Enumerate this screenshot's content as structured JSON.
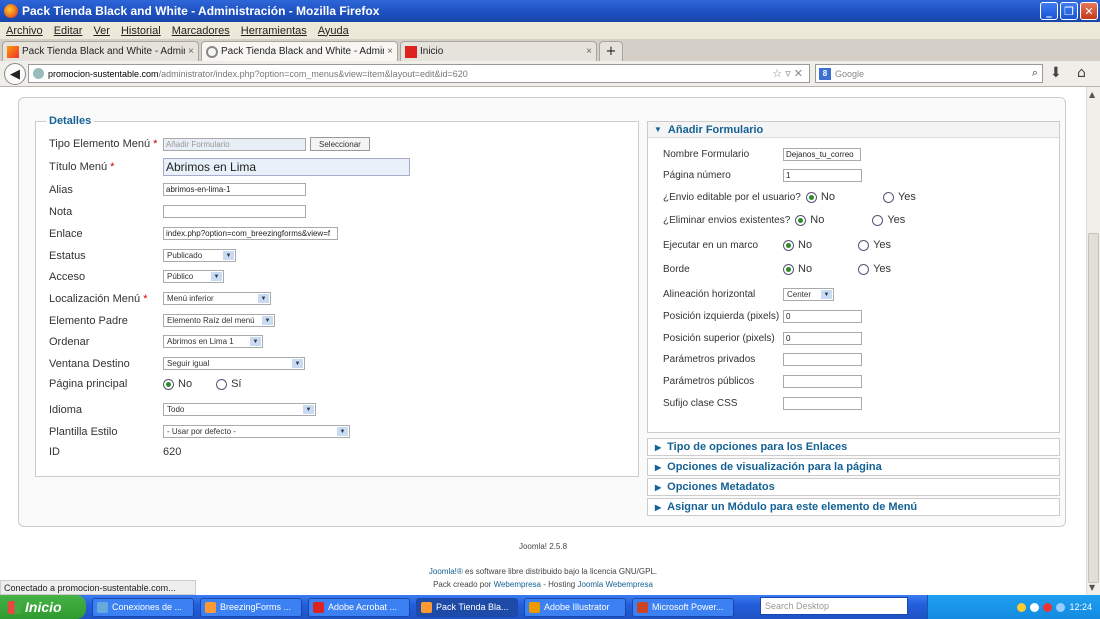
{
  "window": {
    "title": "Pack Tienda Black and White - Administración - Mozilla Firefox"
  },
  "menu": [
    "Archivo",
    "Editar",
    "Ver",
    "Historial",
    "Marcadores",
    "Herramientas",
    "Ayuda"
  ],
  "tabs": [
    {
      "label": "Pack Tienda Black and White - Administra...",
      "close": "×"
    },
    {
      "label": "Pack Tienda Black and White - Administra...",
      "close": "×"
    },
    {
      "label": "Inicio",
      "close": "×"
    }
  ],
  "address": {
    "host": "promocion-sustentable.com",
    "path": "/administrator/index.php?option=com_menus&view=item&layout=edit&id=620",
    "search_placeholder": "Google"
  },
  "details": {
    "legend": "Detalles",
    "fields": {
      "tipo_label": "Tipo Elemento Menú",
      "tipo_value": "Añadir Formulario",
      "select_btn": "Seleccionar",
      "titulo_label": "Título Menú",
      "titulo_value": "Abrimos en Lima",
      "alias_label": "Alias",
      "alias_value": "abrimos-en-lima-1",
      "nota_label": "Nota",
      "nota_value": "",
      "enlace_label": "Enlace",
      "enlace_value": "index.php?option=com_breezingforms&view=f",
      "estatus_label": "Estatus",
      "estatus_value": "Publicado",
      "acceso_label": "Acceso",
      "acceso_value": "Público",
      "localizacion_label": "Localización Menú",
      "localizacion_value": "Menú inferior",
      "padre_label": "Elemento Padre",
      "padre_value": "Elemento Raíz del menú",
      "ordenar_label": "Ordenar",
      "ordenar_value": "Abrimos en Lima 1",
      "ventana_label": "Ventana Destino",
      "ventana_value": "Seguir igual",
      "pagina_label": "Página principal",
      "pagina_no": "No",
      "pagina_si": "Sí",
      "idioma_label": "Idioma",
      "idioma_value": "Todo",
      "plantilla_label": "Plantilla Estilo",
      "plantilla_value": "- Usar por defecto -",
      "id_label": "ID",
      "id_value": "620"
    },
    "required_mark": "*"
  },
  "form_panel": {
    "title": "Añadir Formulario",
    "nombre_label": "Nombre Formulario",
    "nombre_value": "Dejanos_tu_correo",
    "pagina_label": "Página número",
    "pagina_value": "1",
    "envio_label": "¿Envio editable por el usuario?",
    "eliminar_label": "¿Eliminar envios existentes?",
    "marco_label": "Ejecutar en un marco",
    "borde_label": "Borde",
    "no": "No",
    "yes": "Yes",
    "alineacion_label": "Alineación horizontal",
    "alineacion_value": "Center",
    "izq_label": "Posición izquierda (pixels)",
    "izq_value": "0",
    "sup_label": "Posición superior (pixels)",
    "sup_value": "0",
    "privados_label": "Parámetros privados",
    "publicos_label": "Parámetros públicos",
    "sufijo_label": "Sufijo clase CSS"
  },
  "accordions": [
    "Tipo de opciones para los Enlaces",
    "Opciones de visualización para la página",
    "Opciones Metadatos",
    "Asignar un Módulo para este elemento de Menú"
  ],
  "footer": {
    "version": "Joomla! 2.5.8",
    "license_link": "Joomla!®",
    "license_text": " es software libre distribuido bajo la licencia GNU/GPL.",
    "pack_prefix": "Pack creado por ",
    "pack_link1": "Webempresa",
    "pack_mid": " - Hosting ",
    "pack_link2": "Joomla Webempresa"
  },
  "status": "Conectado a promocion-sustentable.com...",
  "taskbar": {
    "start": "Inicio",
    "tasks": [
      "Conexiones de ...",
      "BreezingForms ...",
      "Adobe Acrobat ...",
      "Pack Tienda Bla...",
      "Adobe Illustrator",
      "Microsoft Power..."
    ],
    "search_placeholder": "Search Desktop",
    "clock": "12:24"
  }
}
